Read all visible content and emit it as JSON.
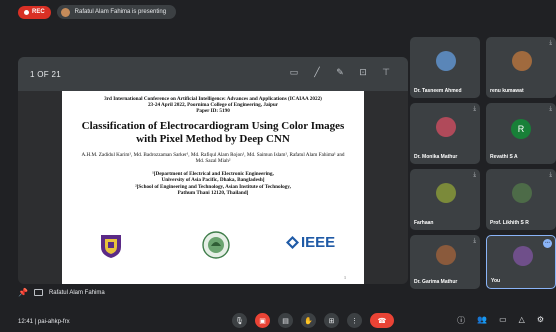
{
  "topbar": {
    "rec_label": "REC",
    "presenting_text": "Rafatul Alam Fahima is presenting"
  },
  "slide": {
    "page_count": "1 OF 21",
    "conference_line1": "3rd International Conference on Artificial Intelligence: Advances and Applications (ICAIAA 2022)",
    "conference_line2": "23-24 April 2022, Poornima College of Engineering, Jaipur",
    "paper_id": "Paper ID: 5190",
    "title": "Classification of Electrocardiogram Using Color Images with Pixel Method by Deep CNN",
    "authors": "A.H.M. Zadidul Karim¹, Md. Badrozzaman Sarker¹, Md. Rafiqul Alam Rojon¹, Md. Saimun Islam¹, Rafatul Alam Fahima¹ and Md. Sazal Miah²",
    "affiliation1a": "¹[Department of Electrical and Electronic Engineering,",
    "affiliation1b": "University of Asia Pacific, Dhaka, Bangladesh]",
    "affiliation2a": "²[School of Engineering and Technology, Asian Institute of Technology,",
    "affiliation2b": "Pathum Thani 12120, Thailand]",
    "ieee_label": "IEEE",
    "page_number": "1"
  },
  "presenter_label": "Rafatul Alam Fahima",
  "participants": [
    {
      "name": "Dr. Tasneem Ahmed"
    },
    {
      "name": "renu kumawat"
    },
    {
      "name": "Dr. Monika Mathur"
    },
    {
      "name": "Revathi S A",
      "initial": "R"
    },
    {
      "name": "Farhaan"
    },
    {
      "name": "Prof. Likhith S R"
    },
    {
      "name": "Dr. Garima Mathur"
    },
    {
      "name": "You"
    }
  ],
  "meeting_info": "12:41  |  pai-ahkp-frx",
  "icons": {
    "mic": "mic-icon",
    "camera": "camera-icon",
    "captions": "captions-icon",
    "raise_hand": "raise-hand-icon",
    "present": "present-icon",
    "more": "more-options-icon",
    "end_call": "end-call-icon"
  },
  "colors": {
    "background": "#202124",
    "rec_red": "#d93025",
    "end_call_red": "#ea4335",
    "active_blue": "#8ab4f8",
    "ieee_blue": "#1f5aa6"
  }
}
